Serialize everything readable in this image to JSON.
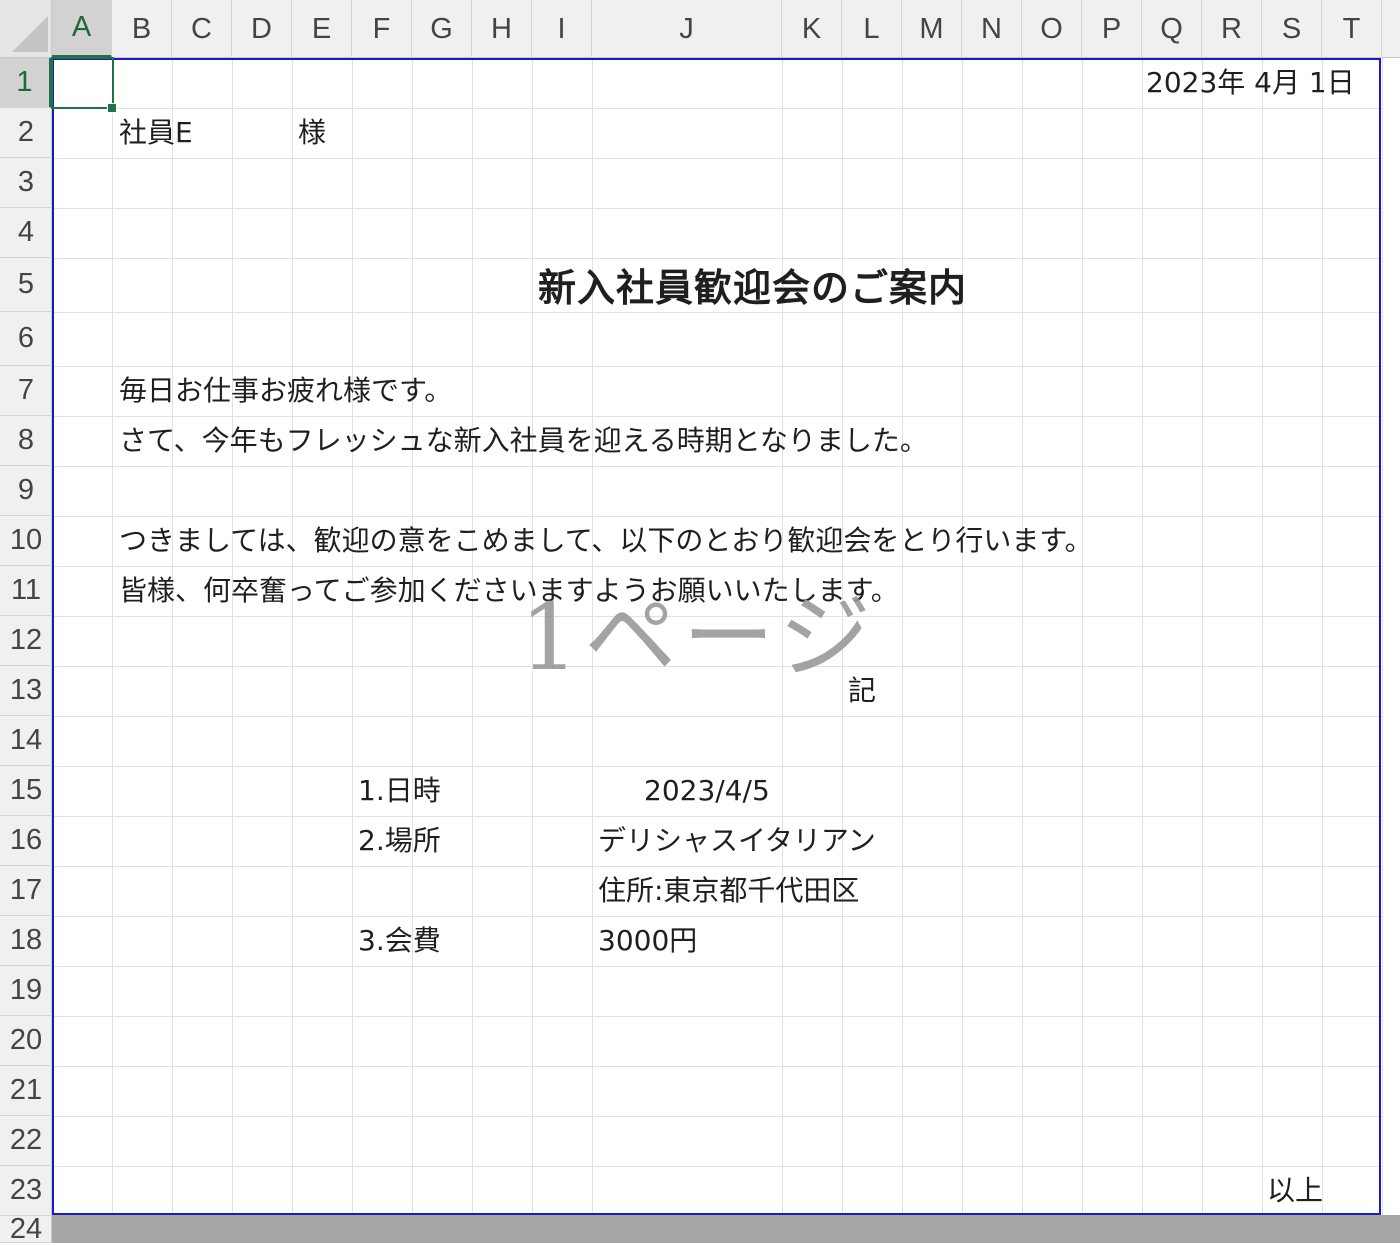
{
  "columns": [
    "A",
    "B",
    "C",
    "D",
    "E",
    "F",
    "G",
    "H",
    "I",
    "J",
    "K",
    "L",
    "M",
    "N",
    "O",
    "P",
    "Q",
    "R",
    "S",
    "T"
  ],
  "rows": [
    "1",
    "2",
    "3",
    "4",
    "5",
    "6",
    "7",
    "8",
    "9",
    "10",
    "11",
    "12",
    "13",
    "14",
    "15",
    "16",
    "17",
    "18",
    "19",
    "20",
    "21",
    "22",
    "23",
    "24"
  ],
  "active_cell": "A1",
  "document": {
    "date": "2023年 4月 1日",
    "recipient": "社員E",
    "honorific": "様",
    "title": "新入社員歓迎会のご案内",
    "body_line1": "毎日お仕事お疲れ様です。",
    "body_line2": "さて、今年もフレッシュな新入社員を迎える時期となりました。",
    "body_line3": "つきましては、歓迎の意をこめまして、以下のとおり歓迎会をとり行います。",
    "body_line4": "皆様、何卒奮ってご参加くださいますようお願いいたします。",
    "ki": "記",
    "items": [
      {
        "label": "1.日時",
        "value": "2023/4/5"
      },
      {
        "label": "2.場所",
        "value": "デリシャスイタリアン"
      },
      {
        "label": "",
        "value": "住所:東京都千代田区"
      },
      {
        "label": "3.会費",
        "value": "3000円"
      }
    ],
    "closing": "以上"
  },
  "page_watermark": "1ページ"
}
